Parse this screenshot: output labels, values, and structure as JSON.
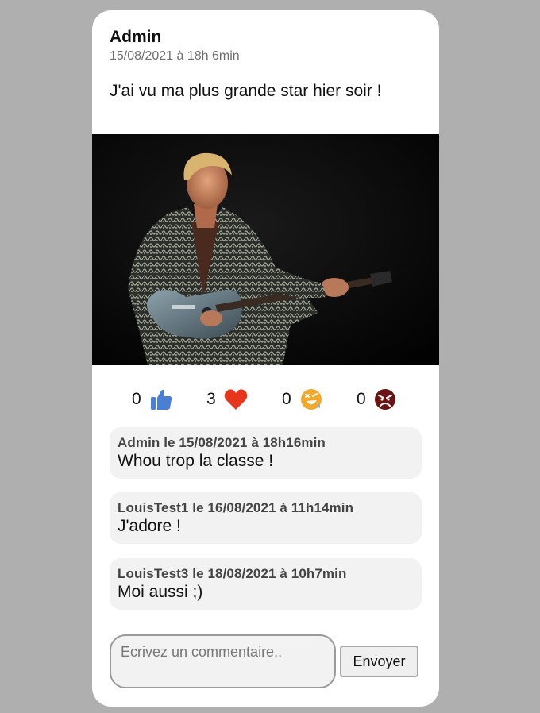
{
  "post": {
    "author": "Admin",
    "date": "15/08/2021 à 18h 6min",
    "text": "J'ai vu ma plus grande star hier soir !",
    "image_description": "Rock guitarist on stage"
  },
  "reactions": [
    {
      "name": "like",
      "icon": "thumbs-up-icon",
      "count": "0",
      "color": "#4a7fd6"
    },
    {
      "name": "love",
      "icon": "heart-icon",
      "count": "3",
      "color": "#e8361d"
    },
    {
      "name": "laugh",
      "icon": "laughing-face-icon",
      "count": "0",
      "color": "#f0a92a"
    },
    {
      "name": "angry",
      "icon": "angry-face-icon",
      "count": "0",
      "color": "#6b1414"
    }
  ],
  "comments": [
    {
      "meta": "Admin le 15/08/2021 à 18h16min",
      "text": "Whou trop la classe !"
    },
    {
      "meta": "LouisTest1 le 16/08/2021 à 11h14min",
      "text": "J'adore !"
    },
    {
      "meta": "LouisTest3 le 18/08/2021 à 10h7min",
      "text": "Moi aussi ;)"
    }
  ],
  "comment_form": {
    "placeholder": "Ecrivez un commentaire..",
    "value": "",
    "submit_label": "Envoyer"
  }
}
